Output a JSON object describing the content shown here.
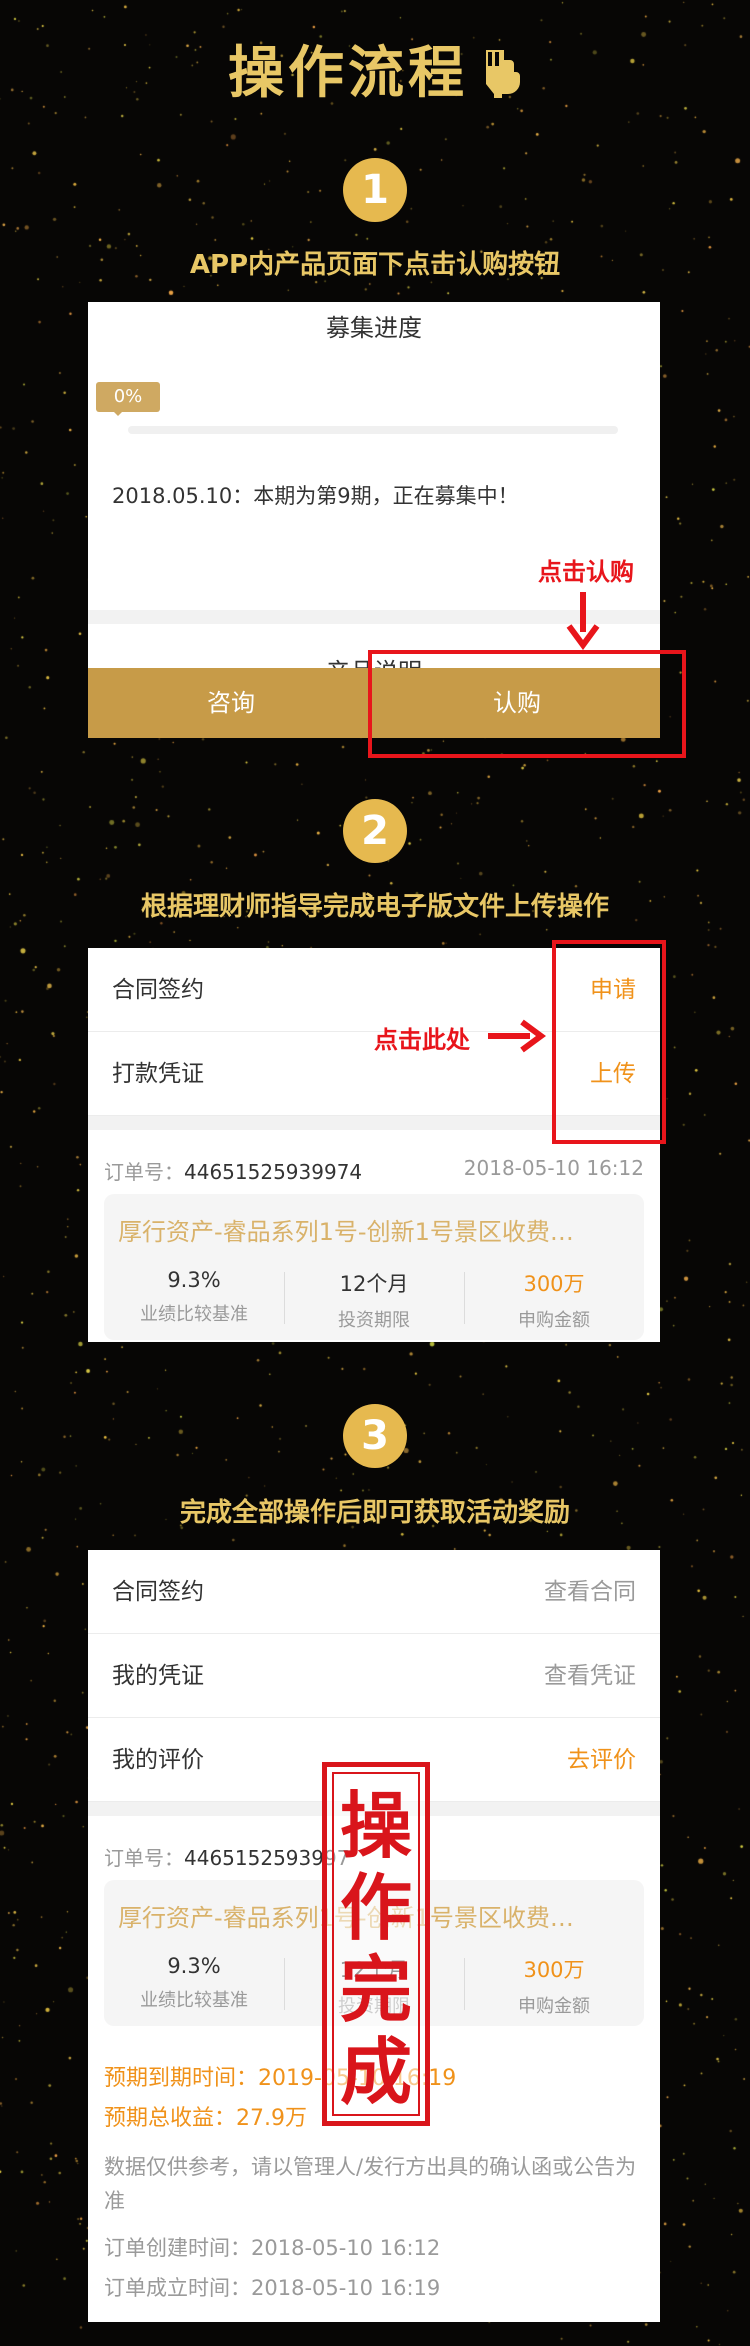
{
  "title": "操作流程",
  "steps": [
    {
      "number": "1",
      "caption": "APP内产品页面下点击认购按钮"
    },
    {
      "number": "2",
      "caption": "根据理财师指导完成电子版文件上传操作"
    },
    {
      "number": "3",
      "caption": "完成全部操作后即可获取活动奖励"
    }
  ],
  "step1": {
    "heading": "募集进度",
    "progress_badge": "0%",
    "progress_value": 0,
    "notice": "2018.05.10：本期为第9期，正在募集中！",
    "next_section": "产品说明",
    "consult_button": "咨询",
    "subscribe_button": "认购",
    "annotation": "点击认购"
  },
  "step2": {
    "rows": [
      {
        "label": "合同签约",
        "action": "申请"
      },
      {
        "label": "打款凭证",
        "action": "上传"
      }
    ],
    "annotation": "点击此处",
    "order": {
      "label": "订单号：",
      "number": "44651525939974",
      "date": "2018-05-10 16:12",
      "product": "厚行资产-睿品系列1号-创新1号景区收费…",
      "metrics": [
        {
          "value": "9.3%",
          "label": "业绩比较基准"
        },
        {
          "value": "12个月",
          "label": "投资期限"
        },
        {
          "value": "300万",
          "label": "申购金额"
        }
      ]
    }
  },
  "step3": {
    "rows": [
      {
        "label": "合同签约",
        "action": "查看合同"
      },
      {
        "label": "我的凭证",
        "action": "查看凭证"
      },
      {
        "label": "我的评价",
        "action": "去评价"
      }
    ],
    "order": {
      "label": "订单号：",
      "number": "4465152593997",
      "product": "厚行资产-睿品系列1号-创新1号景区收费…",
      "metrics": [
        {
          "value": "9.3%",
          "label": "业绩比较基准"
        },
        {
          "value": "12个月",
          "label": "投资期限"
        },
        {
          "value": "300万",
          "label": "申购金额"
        }
      ]
    },
    "expiry_label": "预期到期时间：",
    "expiry_value": "2019-05-10 16:19",
    "income_label": "预期总收益：",
    "income_value": "27.9万",
    "disclaimer": "数据仅供参考，请以管理人/发行方出具的确认函或公告为准",
    "created_label": "订单创建时间：",
    "created_value": "2018-05-10 16:12",
    "established_label": "订单成立时间：",
    "established_value": "2018-05-10 16:19",
    "stamp": "操作完成"
  },
  "colors": {
    "background": "#070605",
    "gold": "#e8c766",
    "button_gold": "#c79b48",
    "orange": "#f0921a",
    "annotation_red": "#e8151b"
  }
}
